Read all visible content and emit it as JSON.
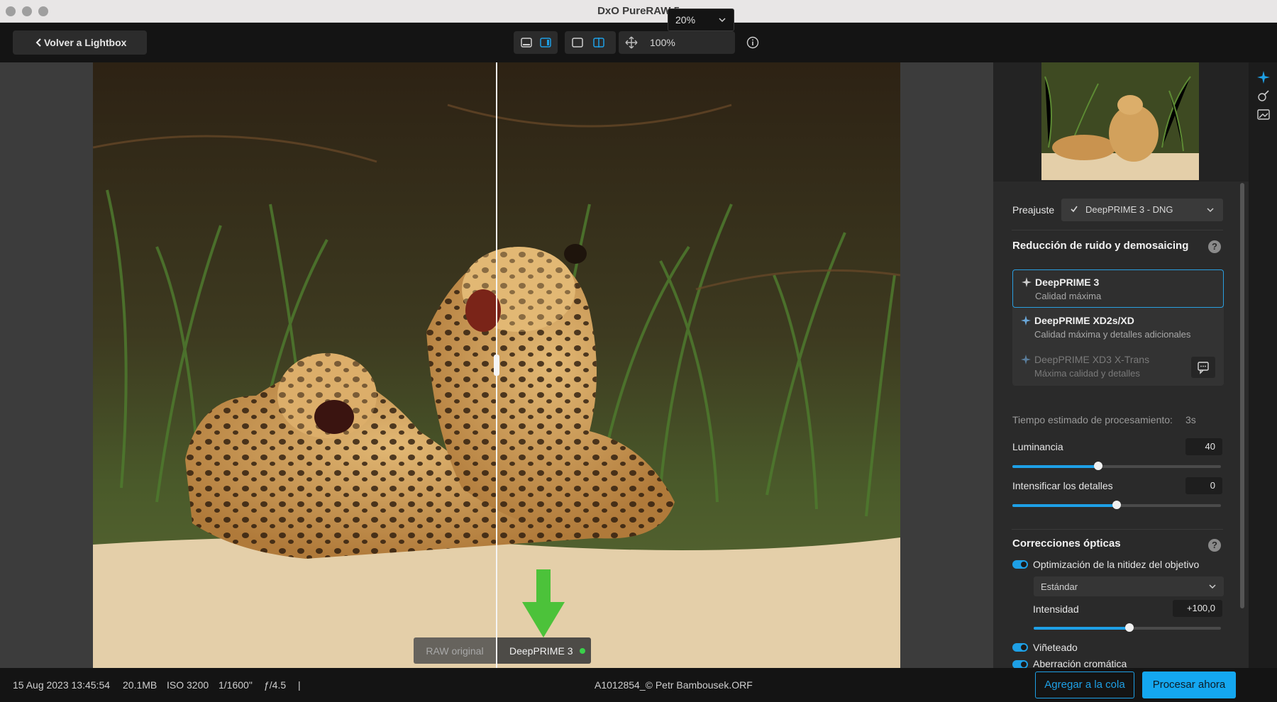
{
  "window": {
    "title": "DxO PureRAW 5"
  },
  "toolbar": {
    "back_label": "Volver a Lightbox",
    "zoom_fit_label": "100%",
    "zoom_value": "20%"
  },
  "viewer": {
    "left_tag": "RAW original",
    "right_tag": "DeepPRIME 3",
    "annotation_arrow_color": "#4cc23a"
  },
  "panel": {
    "preset_label": "Preajuste",
    "preset_value": "DeepPRIME 3 - DNG",
    "noise_section_title": "Reducción de ruido y demosaicing",
    "options": [
      {
        "name": "DeepPRIME 3",
        "desc": "Calidad máxima",
        "selected": true
      },
      {
        "name": "DeepPRIME XD2s/XD",
        "desc": "Calidad máxima y detalles adicionales",
        "selected": false
      },
      {
        "name": "DeepPRIME XD3 X-Trans",
        "desc": "Máxima calidad y detalles",
        "disabled": true
      }
    ],
    "time_label": "Tiempo estimado de procesamiento:",
    "time_value": "3s",
    "luminance_label": "Luminancia",
    "luminance_value": "40",
    "luminance_fraction": 0.41,
    "details_label": "Intensificar los detalles",
    "details_value": "0",
    "details_fraction": 0.5,
    "optical_section_title": "Correcciones ópticas",
    "sharpness_label": "Optimización de la nitidez del objetivo",
    "sharpness_mode": "Estándar",
    "intensity_label": "Intensidad",
    "intensity_value": "+100,0",
    "intensity_fraction": 0.51,
    "vignetting_label": "Viñeteado",
    "chromatic_label": "Aberración cromática"
  },
  "status": {
    "date": "15 Aug 2023 13:45:54",
    "size": "20.1MB",
    "iso": "ISO 3200",
    "shutter": "1/1600\"",
    "aperture": "ƒ/4.5",
    "separator": "|",
    "filename": "A1012854_© Petr Bambousek.ORF",
    "queue_button": "Agregar a la cola",
    "process_button": "Procesar ahora"
  },
  "colors": {
    "accent": "#1ea0e6",
    "process_button": "#14a7f0",
    "green_dot": "#3ad14a"
  }
}
